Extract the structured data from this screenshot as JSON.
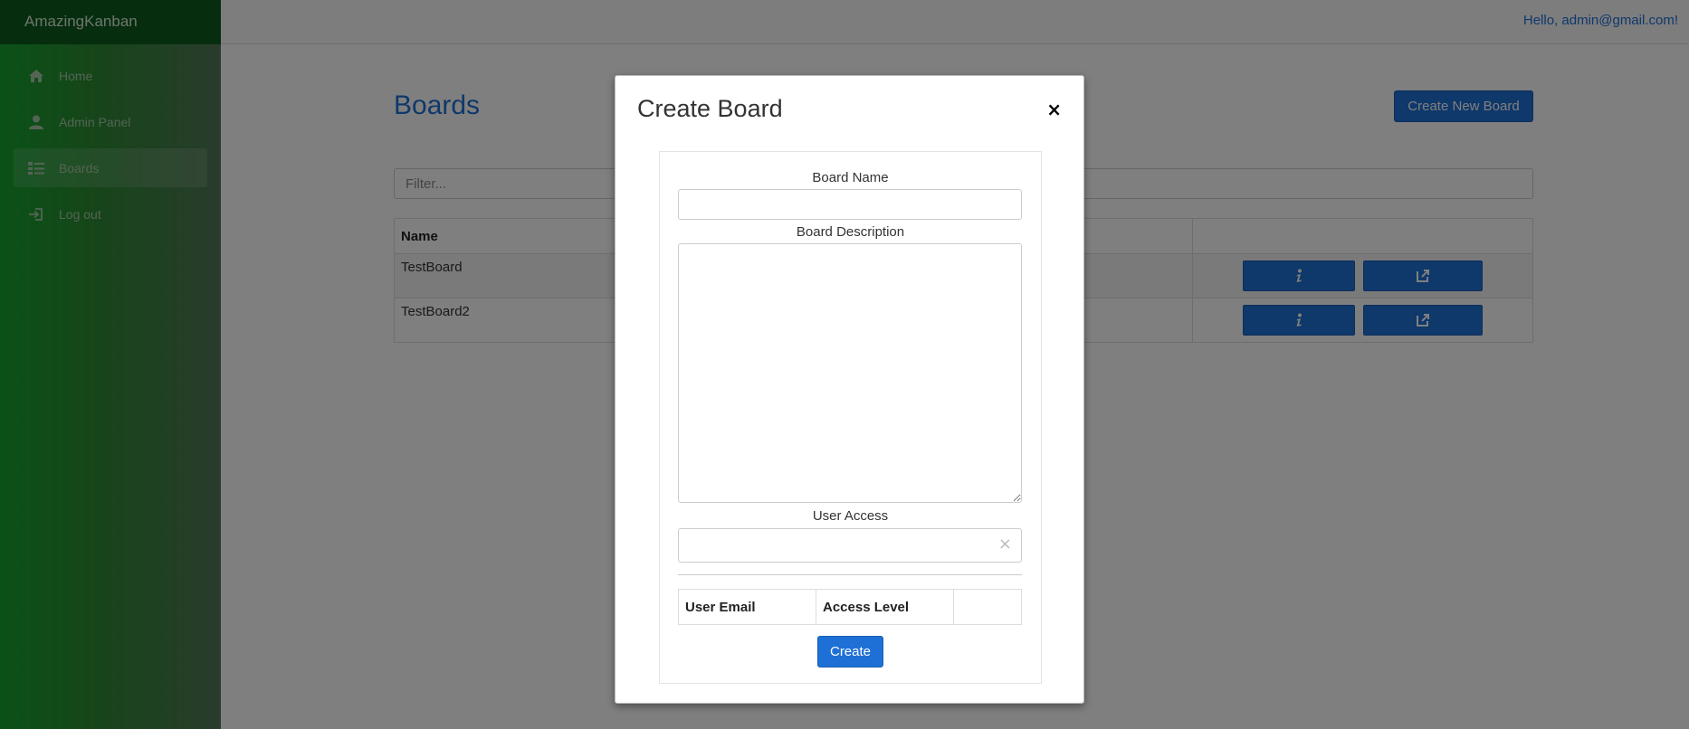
{
  "app": {
    "brand": "AmazingKanban"
  },
  "sidebar": {
    "items": [
      {
        "label": "Home",
        "icon": "home-icon"
      },
      {
        "label": "Admin Panel",
        "icon": "user-icon"
      },
      {
        "label": "Boards",
        "icon": "list-icon",
        "active": true
      },
      {
        "label": "Log out",
        "icon": "logout-icon"
      }
    ]
  },
  "header": {
    "greeting": "Hello, admin@gmail.com!"
  },
  "main": {
    "title": "Boards",
    "create_button": "Create New Board",
    "filter_placeholder": "Filter...",
    "table": {
      "columns": [
        "Name",
        ""
      ],
      "rows": [
        {
          "name": "TestBoard"
        },
        {
          "name": "TestBoard2"
        }
      ],
      "row_actions": [
        "info-icon",
        "external-link-icon"
      ]
    }
  },
  "modal": {
    "title": "Create Board",
    "close_label": "×",
    "board_name_label": "Board Name",
    "board_name_value": "",
    "board_description_label": "Board Description",
    "board_description_value": "",
    "user_access_label": "User Access",
    "user_access_value": "",
    "access_table_columns": [
      "User Email",
      "Access Level",
      ""
    ],
    "create_button": "Create"
  },
  "colors": {
    "accent": "#1e70d6",
    "sidebar_top": "#0d5a1c",
    "sidebar_gradient_start": "#15a32f",
    "sidebar_gradient_end": "#52785a"
  }
}
